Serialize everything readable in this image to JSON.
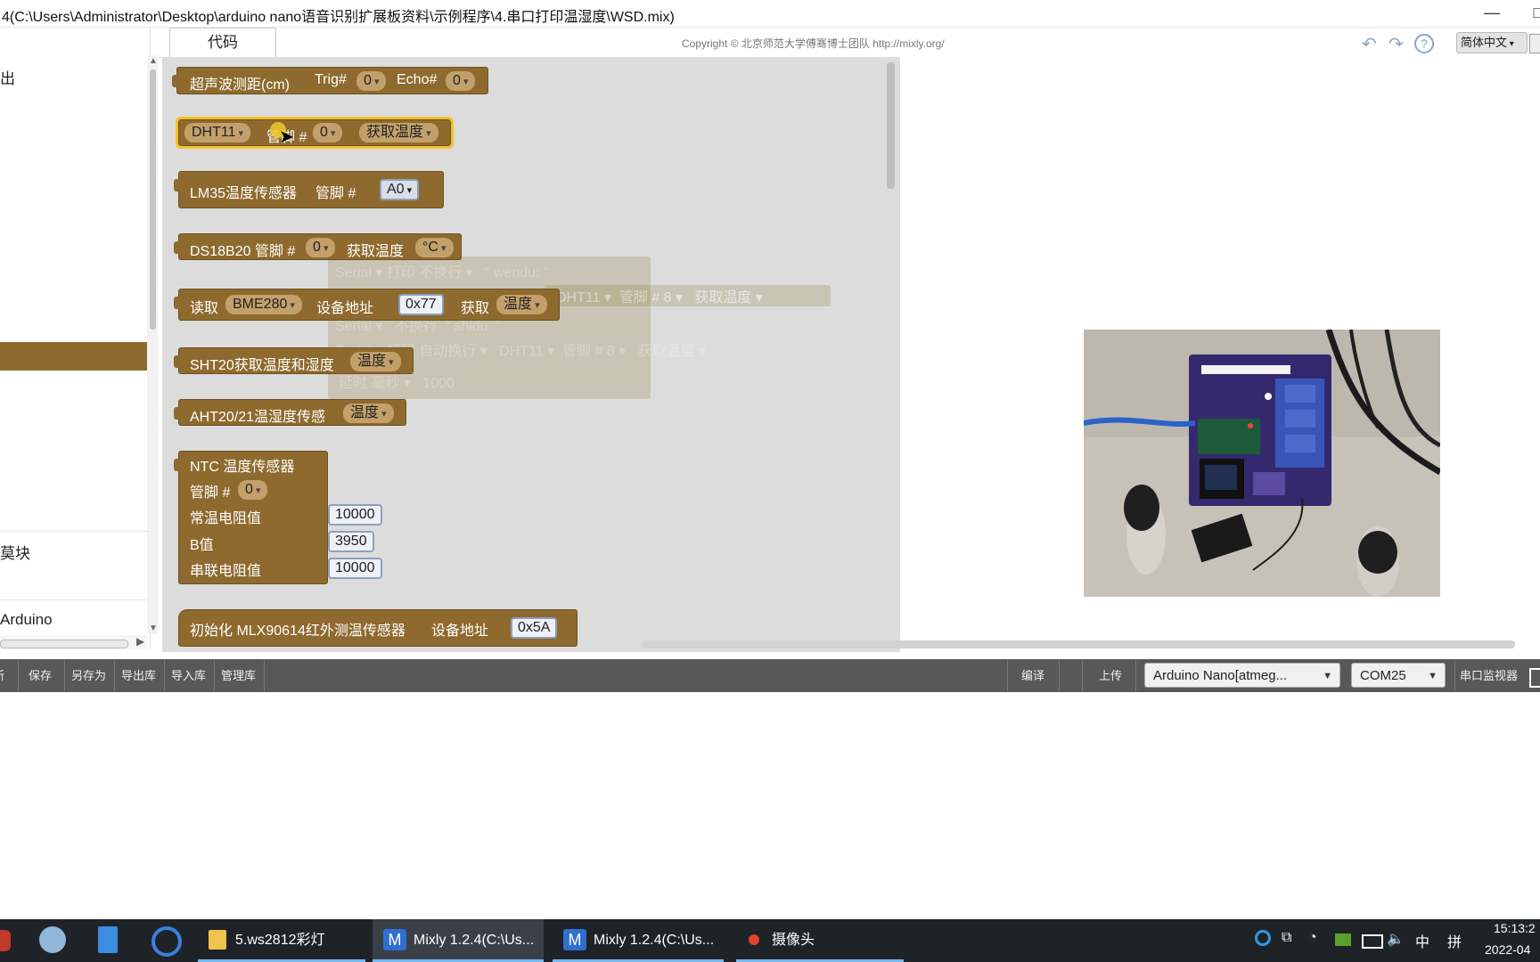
{
  "window": {
    "title": "4(C:\\Users\\Administrator\\Desktop\\arduino nano语音识别扩展板资料\\示例程序\\4.串口打印温湿度\\WSD.mix)",
    "minimize_glyph": "—",
    "maximize_glyph": "□"
  },
  "sidebar": {
    "items": [
      {
        "label": "出"
      },
      {
        "label": "莫块"
      },
      {
        "label": "Arduino"
      }
    ]
  },
  "tabs": {
    "code_label": "代码"
  },
  "header": {
    "copyright": "Copyright © 北京师范大学傅骞博士团队 http://mixly.org/",
    "language": "简体中文",
    "undo_icon": "undo-icon",
    "redo_icon": "redo-icon",
    "help_icon": "help-icon"
  },
  "blocks": {
    "ultrasonic": {
      "label": "超声波测距(cm)",
      "trig_label": "Trig#",
      "trig_value": "0",
      "echo_label": "Echo#",
      "echo_value": "0"
    },
    "dht11": {
      "sensor": "DHT11",
      "pin_label": "管脚 #",
      "pin_value": "0",
      "action": "获取温度"
    },
    "lm35": {
      "label": "LM35温度传感器",
      "pin_label": "管脚 #",
      "pin_value": "A0"
    },
    "ds18b20": {
      "label": "DS18B20 管脚 #",
      "pin_value": "0",
      "action": "获取温度",
      "unit": "°C"
    },
    "bme280": {
      "label": "读取",
      "sensor": "BME280",
      "addr_label": "设备地址",
      "addr_value": "0x77",
      "get_label": "获取",
      "get_value": "温度"
    },
    "sht20": {
      "label": "SHT20获取温度和湿度",
      "value": "温度"
    },
    "aht20": {
      "label": "AHT20/21温湿度传感",
      "value": "温度"
    },
    "ntc": {
      "title": "NTC  温度传感器",
      "pin_label": "管脚 #",
      "pin_value": "0",
      "normal_res_label": "常温电阻值",
      "normal_res_value": "10000",
      "b_label": "B值",
      "b_value": "3950",
      "series_res_label": "串联电阻值",
      "series_res_value": "10000"
    },
    "mlx90614": {
      "label": "初始化 MLX90614红外测温传感器",
      "addr_label": "设备地址",
      "addr_value": "0x5A"
    }
  },
  "ghost_blocks": {
    "line1_serial": "Serial",
    "line1_print": "打印",
    "line1_mode": "不换行",
    "line1_text": "wendu:",
    "line2_sensor": "DHT11",
    "line2_pin_label": "管脚 #",
    "line2_pin": "8",
    "line2_action": "获取温度",
    "line3_serial": "Serial",
    "line3_mode": "不换行",
    "line3_text": "shidu:",
    "line4_serial": "Serial",
    "line4_print": "打印",
    "line4_mode": "自动换行",
    "line4_sensor": "DHT11",
    "line4_pin_label": "管脚 #",
    "line4_pin": "8",
    "line4_action": "获取温度",
    "line5_delay": "延时",
    "line5_unit": "毫秒",
    "line5_value": "1000"
  },
  "toolbar": {
    "new_label": "新",
    "save_label": "保存",
    "save_as_label": "另存为",
    "export_lib_label": "导出库",
    "import_lib_label": "导入库",
    "manage_lib_label": "管理库",
    "compile_label": "编译",
    "upload_label": "上传",
    "board": "Arduino Nano[atmeg...",
    "port": "COM25",
    "serial_monitor_label": "串口监视器"
  },
  "taskbar": {
    "apps": [
      {
        "label": "5.ws2812彩灯",
        "icon": "folder-icon"
      },
      {
        "label": "Mixly 1.2.4(C:\\Us...",
        "icon": "mixly-icon"
      },
      {
        "label": "Mixly 1.2.4(C:\\Us...",
        "icon": "mixly-icon"
      },
      {
        "label": "摄像头",
        "icon": "camera-icon"
      }
    ],
    "ime": "中",
    "ime2": "拼",
    "time": "15:13:2",
    "date": "2022-04"
  },
  "colors": {
    "block_brown": "#8e6a2e",
    "dropdown": "#c3a06a",
    "selection": "#f6c12a",
    "toolbar": "#585858",
    "taskbar": "#1f2328",
    "flyout": "#dcdcdc"
  }
}
